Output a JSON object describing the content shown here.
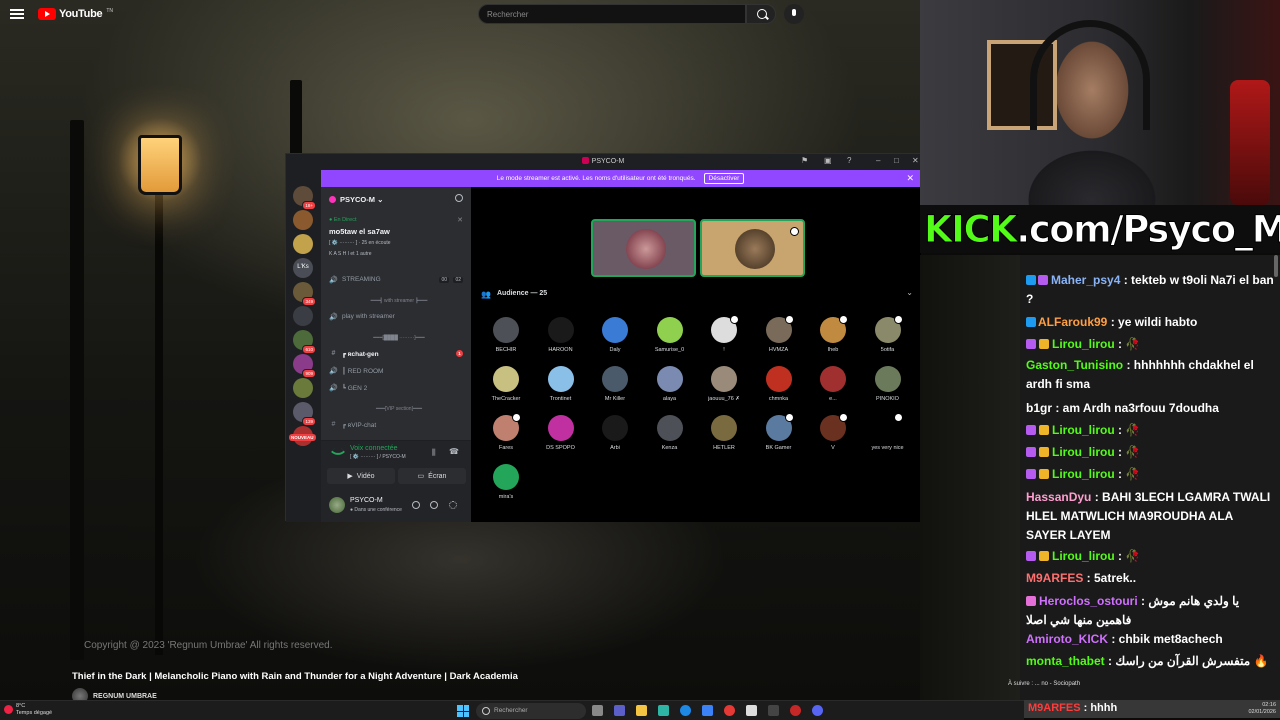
{
  "youtube": {
    "logo_text": "YouTube",
    "logo_sup": "TN",
    "search_placeholder": "Rechercher",
    "copyright": "Copyright @ 2023 'Regnum Umbrae' All rights reserved.",
    "video_title": "Thief in the Dark | Melancholic Piano with Rain and Thunder for a Night Adventure | Dark Academia",
    "channel_name": "REGNUM UMBRAE"
  },
  "discord": {
    "window_title": "PSYCO-M",
    "banner_text": "Le mode streamer est activé. Les noms d'utilisateur ont été tronqués.",
    "banner_button": "Désactiver",
    "server_name": "PSYCO-M",
    "live_label": "En Direct",
    "event_title": "mo5taw el sa7aw",
    "event_meta": "[ ⚙️ ········· ] · 25 en écoute",
    "event_users": "K A S H I et 1 autre",
    "servers": [
      {
        "badge": "18+",
        "color": "#5e4b3a"
      },
      {
        "badge": "",
        "color": "#8a5a2e"
      },
      {
        "badge": "",
        "color": "#c2a24a"
      },
      {
        "badge": "",
        "color": "#4a4d55",
        "label": "L'Ks"
      },
      {
        "badge": "349",
        "color": "#6b5a3a"
      },
      {
        "badge": "",
        "color": "#3b3d44"
      },
      {
        "badge": "610",
        "color": "#4d6b3a"
      },
      {
        "badge": "909",
        "color": "#8a3b8a"
      },
      {
        "badge": "",
        "color": "#6a7a3a"
      },
      {
        "badge": "139",
        "color": "#5a5a6a"
      },
      {
        "badge": "",
        "color": "#aa3030"
      }
    ],
    "server_new_label": "NOUVEAU",
    "channels": {
      "streaming": "STREAMING",
      "streaming_count_a": "00",
      "streaming_count_b": "02",
      "cat_streamer": "━━━┫ with streamer ┣━━━",
      "play_streamer": "play with streamer",
      "cat_chat": "━━━[████ ·········]━━━",
      "chat_gen": "┏ ʀchat-gen",
      "red_room": "┃ RED ROOM",
      "gen2": "┗ GEN 2",
      "cat_vip": "━━━[VIP section]━━━",
      "vip_chat": "┏ ʀVIP-chat"
    },
    "voice": {
      "status": "Voix connectée",
      "sub": "[ ⚙️ ········· ] / PSYCO-M",
      "video_label": "Vidéo",
      "screen_label": "Écran"
    },
    "user": {
      "name": "PSYCO-M",
      "status": "Dans une conférence"
    },
    "audience_label": "Audience — 25",
    "audience": [
      {
        "name": "BECHIR",
        "color": "#4e5058",
        "badge": false
      },
      {
        "name": "HAROON",
        "color": "#1a1a1a",
        "badge": false
      },
      {
        "name": "Daly",
        "color": "#3a7bd5",
        "badge": false
      },
      {
        "name": "Samurise_0",
        "color": "#8fd14f",
        "badge": false
      },
      {
        "name": "!",
        "color": "#ddd",
        "badge": true
      },
      {
        "name": "HVMZA",
        "color": "#7a6a5a",
        "badge": true
      },
      {
        "name": "Iheb",
        "color": "#c08a40",
        "badge": true
      },
      {
        "name": "5otifa",
        "color": "#8a8a6a",
        "badge": true
      },
      {
        "name": "TheCracker",
        "color": "#c8c080",
        "badge": false
      },
      {
        "name": "Trontinet",
        "color": "#8ac0e8",
        "badge": false
      },
      {
        "name": "Mr Killer",
        "color": "#4a5a6a",
        "badge": false
      },
      {
        "name": "alaya",
        "color": "#7a8ab0",
        "badge": false
      },
      {
        "name": "jaouuu_76 ✗",
        "color": "#9a8a7a",
        "badge": false
      },
      {
        "name": "chmnka",
        "color": "#c03020",
        "badge": false
      },
      {
        "name": "e...",
        "color": "#a03030",
        "badge": false
      },
      {
        "name": "PINOKIO",
        "color": "#6a7a5a",
        "badge": false
      },
      {
        "name": "Fares",
        "color": "#c08070",
        "badge": true
      },
      {
        "name": "DS SPOPO",
        "color": "#c030a0",
        "badge": false
      },
      {
        "name": "Arbi",
        "color": "#1a1a1a",
        "badge": false
      },
      {
        "name": "Kenza",
        "color": "#4e5058",
        "badge": false
      },
      {
        "name": "HETLER",
        "color": "#7a6a40",
        "badge": false
      },
      {
        "name": "BK Gamer",
        "color": "#5a7aa0",
        "badge": true
      },
      {
        "name": "V",
        "color": "#6a3020",
        "badge": true
      },
      {
        "name": "yes very nice",
        "color": "#000",
        "badge": true
      },
      {
        "name": "mira's",
        "color": "#23a55a",
        "badge": false
      }
    ]
  },
  "kick": {
    "logo": "KICK",
    "url": ".com/Psyco_M"
  },
  "chat": {
    "messages": [
      {
        "user": "Maher_psy4",
        "color": "#8ab4f8",
        "badges": 2,
        "text": " : tekteb w t9oli Na7i el ban ? "
      },
      {
        "user": "ALFarouk99",
        "color": "#ff9f43",
        "badges": 1,
        "text": " : ye wildi habto"
      },
      {
        "user": "Lirou_lirou",
        "color": "#53fc18",
        "badges": 3,
        "text": " : 🥀"
      },
      {
        "user": "Gaston_Tunisino",
        "color": "#53fc18",
        "badges": 0,
        "text": " : hhhhhhh chdakhel el ardh fi sma"
      },
      {
        "user": "b1gr",
        "color": "#ffffff",
        "badges": 0,
        "text": " : am Ardh na3rfouu 7doudha"
      },
      {
        "user": "Lirou_lirou",
        "color": "#53fc18",
        "badges": 3,
        "text": " : 🥀"
      },
      {
        "user": "Lirou_lirou",
        "color": "#53fc18",
        "badges": 3,
        "text": " : 🥀"
      },
      {
        "user": "Lirou_lirou",
        "color": "#53fc18",
        "badges": 3,
        "text": " : 🥀"
      },
      {
        "user": "HassanDyu",
        "color": "#ff9fd0",
        "badges": 0,
        "text": " : BAHI 3LECH LGAMRA TWALI HLEL MATWLICH MA9ROUDHA ALA SAYER LAYEM"
      },
      {
        "user": "Lirou_lirou",
        "color": "#53fc18",
        "badges": 3,
        "text": " : 🥀"
      },
      {
        "user": "M9ARFES",
        "color": "#ff7070",
        "badges": 0,
        "text": " : 5atrek.."
      },
      {
        "user": "Heroclos_ostouri",
        "color": "#d070ff",
        "badges": 4,
        "text": " : يا ولدي هانم موش فاهمين منها شي اصلا"
      },
      {
        "user": "Amiroto_KICK",
        "color": "#d070ff",
        "badges": 0,
        "text": " : chbik met8achech"
      },
      {
        "user": "monta_thabet",
        "color": "#53fc18",
        "badges": 0,
        "text": " : متفسرش القرآن من راسك 🔥"
      }
    ],
    "footer_user": "M9ARFES",
    "footer_text": " : hhhh",
    "now_playing": "À suivre : ... no - Sociopath"
  },
  "taskbar": {
    "weather_temp": "8°C",
    "weather_desc": "Temps dégagé",
    "search_placeholder": "Rechercher",
    "time": "02:16",
    "date": "02/01/2026"
  }
}
